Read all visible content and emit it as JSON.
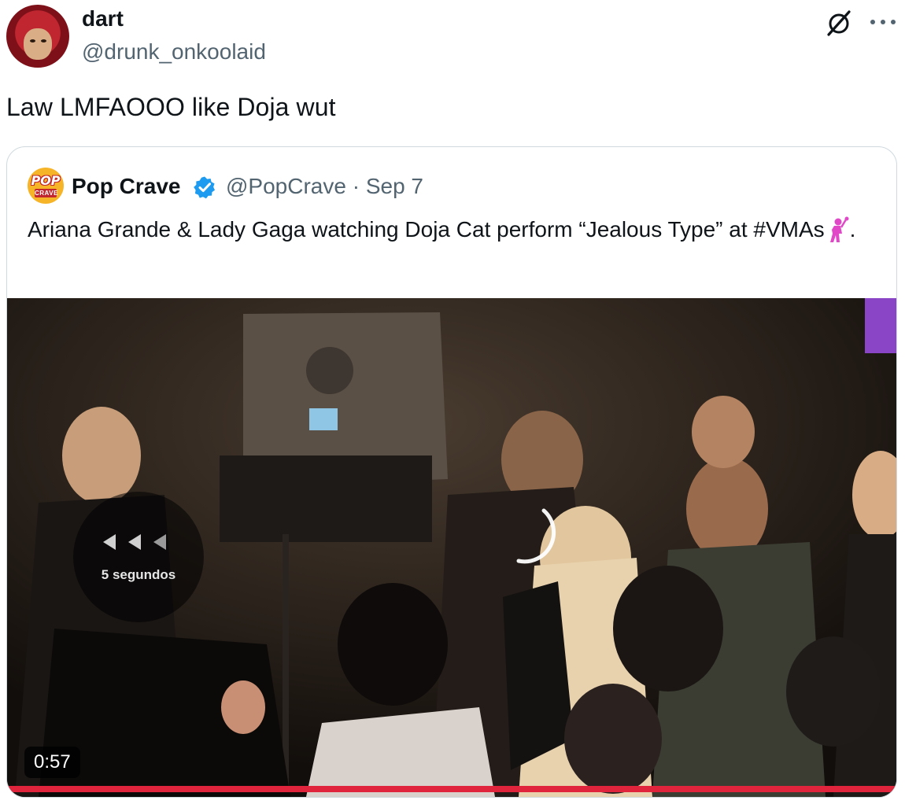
{
  "author": {
    "name": "dart",
    "handle": "@drunk_onkoolaid"
  },
  "tweet": {
    "text": "Law LMFAOOO like Doja wut"
  },
  "icons": {
    "header_actions": [
      "grok-icon",
      "more-icon"
    ],
    "quote_verified": "verified-badge-icon",
    "quote_emoji": "woman-with-microphone-emoji"
  },
  "quoted_tweet": {
    "logo_text_top": "POP",
    "logo_text_bottom": "CRAVE",
    "name": "Pop Crave",
    "handle_and_date": "@PopCrave · Sep 7",
    "text": "Ariana Grande & Lady Gaga watching Doja Cat perform “Jealous Type” at #VMAs",
    "text_end": "."
  },
  "video": {
    "rewind_label": "5 segundos",
    "duration": "0:57",
    "progress_fraction": 1.0
  },
  "colors": {
    "accent_verified": "#1d9bf0",
    "progress": "#e0243b",
    "text_primary": "#0f1419",
    "text_secondary": "#536471"
  }
}
